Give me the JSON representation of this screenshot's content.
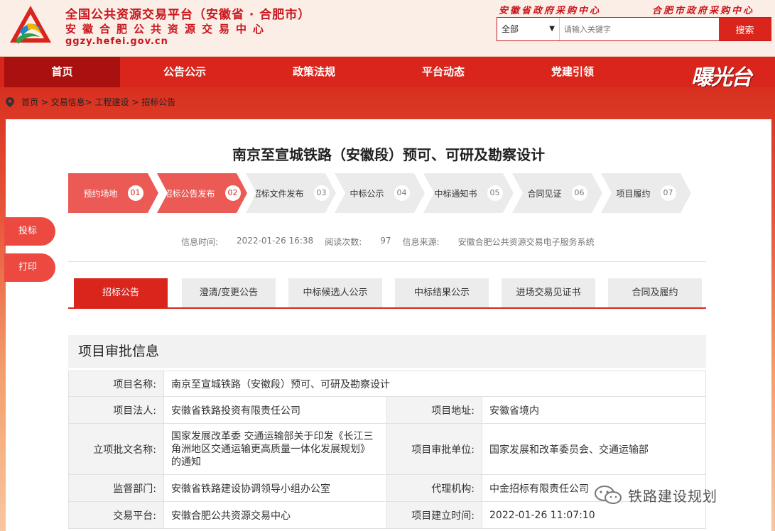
{
  "header": {
    "title": "全国公共资源交易平台（安徽省 · 合肥市）",
    "subtitle": "安徽合肥公共资源交易中心",
    "domain": "ggzy.hefei.gov.cn",
    "link_left": "安徽省政府采购中心",
    "link_right": "合肥市政府采购中心",
    "colors": {
      "brand_red": "#c8161d",
      "nav_red": "#d9251c"
    }
  },
  "search": {
    "scope": "全部",
    "placeholder": "请输入关键字",
    "button": "搜索"
  },
  "nav": {
    "items": [
      "首页",
      "公告公示",
      "政策法规",
      "平台动态",
      "党建引领"
    ],
    "brand": "曝光台"
  },
  "breadcrumb": "首页 > 交易信息> 工程建设 > 招标公告",
  "page": {
    "title": "南京至宣城铁路（安徽段）预可、可研及勘察设计"
  },
  "steps": [
    {
      "label": "预约场地",
      "num": "01",
      "done": true
    },
    {
      "label": "招标公告发布",
      "num": "02",
      "done": true
    },
    {
      "label": "招标文件发布",
      "num": "03",
      "done": false
    },
    {
      "label": "中标公示",
      "num": "04",
      "done": false
    },
    {
      "label": "中标通知书",
      "num": "05",
      "done": false
    },
    {
      "label": "合同见证",
      "num": "06",
      "done": false
    },
    {
      "label": "项目履约",
      "num": "07",
      "done": false
    }
  ],
  "info": {
    "time_label": "信息时间:",
    "time_value": "2022-01-26 16:38",
    "views_label": "阅读次数:",
    "views_value": "97",
    "source_label": "信息来源:",
    "source_value": "安徽合肥公共资源交易电子服务系统"
  },
  "tabs": [
    "招标公告",
    "澄清/变更公告",
    "中标候选人公示",
    "中标结果公示",
    "进场交易见证书",
    "合同及履约"
  ],
  "section": {
    "title": "项目审批信息",
    "rows": {
      "name_k": "项目名称:",
      "name_v": "南京至宣城铁路（安徽段）预可、可研及勘察设计",
      "legal_k": "项目法人:",
      "legal_v": "安徽省铁路投资有限责任公司",
      "addr_k": "项目地址:",
      "addr_v": "安徽省境内",
      "doc_k": "立项批文名称:",
      "doc_v": "国家发展改革委 交通运输部关于印发《长江三角洲地区交通运输更高质量一体化发展规划》的通知",
      "approver_k": "项目审批单位:",
      "approver_v": "国家发展和改革委员会、交通运输部",
      "super_k": "监督部门:",
      "super_v": "安徽省铁路建设协调领导小组办公室",
      "agent_k": "代理机构:",
      "agent_v": "中金招标有限责任公司",
      "platform_k": "交易平台:",
      "platform_v": "安徽合肥公共资源交易中心",
      "created_k": "项目建立时间:",
      "created_v": "2022-01-26 11:07:10"
    }
  },
  "side": {
    "bid": "投标",
    "print": "打印"
  },
  "watermark": "铁路建设规划"
}
